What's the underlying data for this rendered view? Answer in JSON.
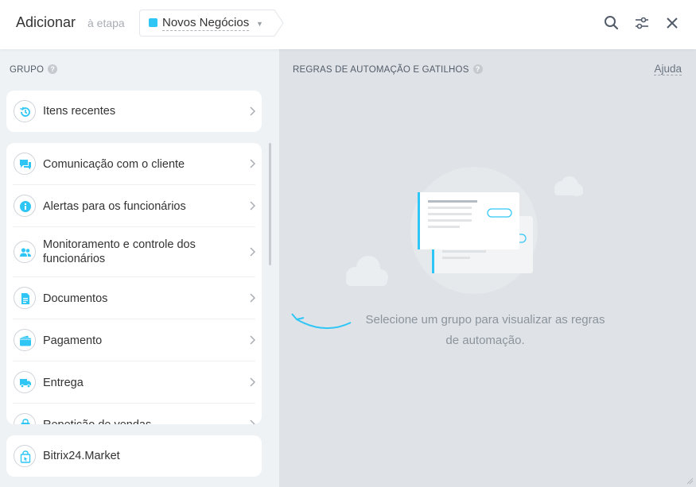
{
  "header": {
    "title": "Adicionar",
    "stage_prefix": "à etapa",
    "stage_name": "Novos Negócios",
    "stage_color": "#2fc6f6"
  },
  "left": {
    "group_title": "GRUPO",
    "recent": {
      "label": "Itens recentes",
      "icon": "history-icon"
    },
    "items": [
      {
        "label": "Comunicação com o cliente",
        "icon": "chat-icon"
      },
      {
        "label": "Alertas para os funcionários",
        "icon": "info-icon"
      },
      {
        "label": "Monitoramento e controle dos funcionários",
        "icon": "users-icon"
      },
      {
        "label": "Documentos",
        "icon": "document-icon"
      },
      {
        "label": "Pagamento",
        "icon": "wallet-icon"
      },
      {
        "label": "Entrega",
        "icon": "truck-icon"
      },
      {
        "label": "Repetição de vendas",
        "icon": "bag-icon"
      }
    ],
    "market": {
      "label": "Bitrix24.Market",
      "icon": "market-bag-icon"
    }
  },
  "right": {
    "title": "REGRAS DE AUTOMAÇÃO E GATILHOS",
    "help": "Ajuda",
    "empty_message": "Selecione um grupo para visualizar as regras de automação."
  },
  "colors": {
    "accent": "#2fc6f6",
    "right_bg": "#dfe3e7",
    "left_bg": "#eef2f4"
  }
}
